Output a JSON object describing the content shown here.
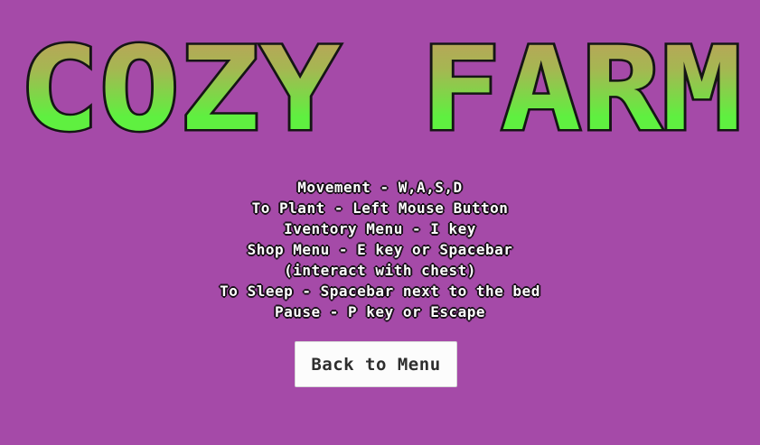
{
  "game": {
    "title": "COZY FARM",
    "title_gradient": [
      "#c49a5c",
      "#5ff040"
    ],
    "title_outline": "#151515",
    "background": "#a54aa8"
  },
  "instructions": {
    "lines": [
      "Movement - W,A,S,D",
      "To Plant - Left Mouse Button",
      "Iventory Menu - I key",
      "Shop Menu - E key or Spacebar",
      "(interact with chest)",
      "To Sleep - Spacebar next to the bed",
      "Pause - P key or Escape"
    ]
  },
  "menu": {
    "back_label": "Back to Menu"
  }
}
